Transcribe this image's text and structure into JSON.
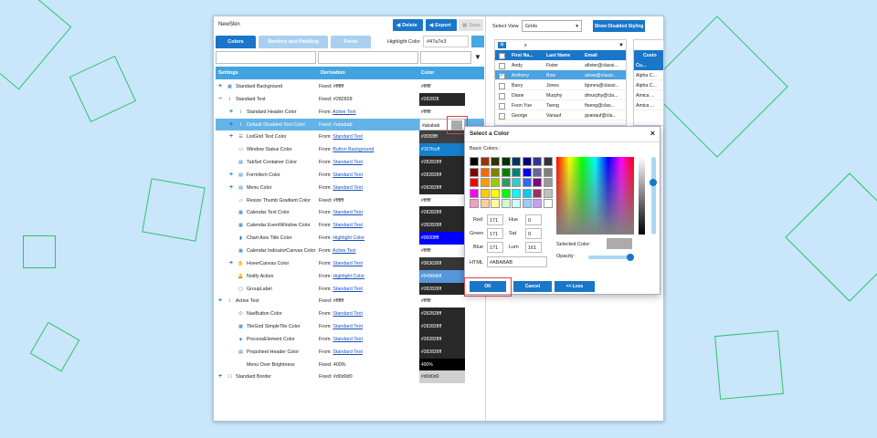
{
  "window": {
    "title": "NewSkin"
  },
  "toolbar": {
    "delete": "Delete",
    "export": "Export",
    "save": "Save"
  },
  "tabs": [
    "Colors",
    "Borders and Padding",
    "Fonts"
  ],
  "highlight": {
    "label": "Highlight Color",
    "value": "#47a7e3",
    "color": "#47a7e3"
  },
  "table": {
    "headers": {
      "settings": "Settings",
      "derivation": "Derivation",
      "color": "Color"
    },
    "rows": [
      {
        "name": "Standard Background",
        "deriv_prefix": "Fixed:",
        "deriv_link": "",
        "deriv_fixed": "#ffffff",
        "value": "#ffffff",
        "swatch": "#ffffff",
        "text_color": "#222222",
        "indent": 0,
        "expander": "+",
        "icon": "grid",
        "selected": false
      },
      {
        "name": "Standard Text",
        "deriv_prefix": "Fixed:",
        "deriv_link": "",
        "deriv_fixed": "#282828",
        "value": "#282828",
        "swatch": "#282828",
        "text_color": "#ffffff",
        "indent": 0,
        "expander": "−",
        "icon": "text",
        "selected": false
      },
      {
        "name": "Standard Header Color",
        "deriv_prefix": "From:",
        "deriv_link": "Active Text",
        "deriv_fixed": "",
        "value": "#ffffff",
        "swatch": "#ffffff",
        "text_color": "#222222",
        "indent": 1,
        "expander": "+",
        "icon": "text",
        "selected": false
      },
      {
        "name": "Default Disabled Text Color",
        "deriv_prefix": "Fixed:",
        "deriv_link": "",
        "deriv_fixed": "#ababab",
        "value": "#ababab",
        "swatch": "#ffffff",
        "text_color": "#222222",
        "indent": 1,
        "expander": "+",
        "icon": "text",
        "selected": true
      },
      {
        "name": "ListGrid Text Color",
        "deriv_prefix": "From:",
        "deriv_link": "Standard Text",
        "deriv_fixed": "",
        "value": "#3f3f3fff",
        "swatch": "#3f3f3f",
        "text_color": "#ffffff",
        "indent": 1,
        "expander": "+",
        "icon": "list",
        "selected": false
      },
      {
        "name": "Window Status Color",
        "deriv_prefix": "From:",
        "deriv_link": "Button Background",
        "deriv_fixed": "",
        "value": "#157fccff",
        "swatch": "#157fcc",
        "text_color": "#ffffff",
        "indent": 1,
        "expander": "",
        "icon": "window",
        "selected": false
      },
      {
        "name": "TabSet Container Color",
        "deriv_prefix": "From:",
        "deriv_link": "Standard Text",
        "deriv_fixed": "",
        "value": "#282828ff",
        "swatch": "#282828",
        "text_color": "#ffffff",
        "indent": 1,
        "expander": "",
        "icon": "tab",
        "selected": false
      },
      {
        "name": "FormItem Color",
        "deriv_prefix": "From:",
        "deriv_link": "Standard Text",
        "deriv_fixed": "",
        "value": "#282828ff",
        "swatch": "#282828",
        "text_color": "#ffffff",
        "indent": 1,
        "expander": "+",
        "icon": "form",
        "selected": false
      },
      {
        "name": "Menu Color",
        "deriv_prefix": "From:",
        "deriv_link": "Standard Text",
        "deriv_fixed": "",
        "value": "#282828ff",
        "swatch": "#282828",
        "text_color": "#ffffff",
        "indent": 1,
        "expander": "+",
        "icon": "menu",
        "selected": false
      },
      {
        "name": "Resize Thumb Gradient Color",
        "deriv_prefix": "Fixed:",
        "deriv_link": "",
        "deriv_fixed": "#ffffff",
        "value": "#ffffff",
        "swatch": "#ffffff",
        "text_color": "#222222",
        "indent": 1,
        "expander": "",
        "icon": "resize",
        "selected": false
      },
      {
        "name": "Calendar Text Color",
        "deriv_prefix": "From:",
        "deriv_link": "Standard Text",
        "deriv_fixed": "",
        "value": "#282828ff",
        "swatch": "#282828",
        "text_color": "#ffffff",
        "indent": 1,
        "expander": "",
        "icon": "calendar",
        "selected": false
      },
      {
        "name": "Calendar EventWindow Color",
        "deriv_prefix": "From:",
        "deriv_link": "Standard Text",
        "deriv_fixed": "",
        "value": "#282828ff",
        "swatch": "#282828",
        "text_color": "#ffffff",
        "indent": 1,
        "expander": "",
        "icon": "calendar",
        "selected": false
      },
      {
        "name": "Chart Axis Title Color",
        "deriv_prefix": "From:",
        "deriv_link": "Highlight Color",
        "deriv_fixed": "",
        "value": "#0000ffff",
        "swatch": "#0000ff",
        "text_color": "#ffffff",
        "indent": 1,
        "expander": "",
        "icon": "chart",
        "selected": false
      },
      {
        "name": "Calendar IndicatorCanvas Color",
        "deriv_prefix": "From:",
        "deriv_link": "Active Text",
        "deriv_fixed": "",
        "value": "#ffffff",
        "swatch": "#ffffff",
        "text_color": "#222222",
        "indent": 1,
        "expander": "",
        "icon": "calendar",
        "selected": false
      },
      {
        "name": "HoverCanvas Color",
        "deriv_prefix": "From:",
        "deriv_link": "Standard Text",
        "deriv_fixed": "",
        "value": "#363636ff",
        "swatch": "#363636",
        "text_color": "#ffffff",
        "indent": 1,
        "expander": "+",
        "icon": "hand",
        "selected": false
      },
      {
        "name": "Notify Action",
        "deriv_prefix": "From:",
        "deriv_link": "Highlight Color",
        "deriv_fixed": "",
        "value": "#5498dbff",
        "swatch": "#5498db",
        "text_color": "#ffffff",
        "indent": 1,
        "expander": "",
        "icon": "bell",
        "selected": false
      },
      {
        "name": "GroupLabel",
        "deriv_prefix": "From:",
        "deriv_link": "Standard Text",
        "deriv_fixed": "",
        "value": "#282828ff",
        "swatch": "#282828",
        "text_color": "#ffffff",
        "indent": 1,
        "expander": "",
        "icon": "group",
        "selected": false
      },
      {
        "name": "Active Text",
        "deriv_prefix": "Fixed:",
        "deriv_link": "",
        "deriv_fixed": "#ffffff",
        "value": "#ffffff",
        "swatch": "#ffffff",
        "text_color": "#222222",
        "indent": 0,
        "expander": "+",
        "icon": "text",
        "selected": false
      },
      {
        "name": "NavButton Color",
        "deriv_prefix": "From:",
        "deriv_link": "Standard Text",
        "deriv_fixed": "",
        "value": "#282828ff",
        "swatch": "#282828",
        "text_color": "#ffffff",
        "indent": 1,
        "expander": "",
        "icon": "power",
        "selected": false
      },
      {
        "name": "TileGrid SimpleTile Color",
        "deriv_prefix": "From:",
        "deriv_link": "Standard Text",
        "deriv_fixed": "",
        "value": "#282828ff",
        "swatch": "#282828",
        "text_color": "#ffffff",
        "indent": 1,
        "expander": "",
        "icon": "tile",
        "selected": false
      },
      {
        "name": "ProcessElement Color",
        "deriv_prefix": "From:",
        "deriv_link": "Standard Text",
        "deriv_fixed": "",
        "value": "#282828ff",
        "swatch": "#282828",
        "text_color": "#ffffff",
        "indent": 1,
        "expander": "",
        "icon": "process",
        "selected": false
      },
      {
        "name": "Propsheet Header Color",
        "deriv_prefix": "From:",
        "deriv_link": "Standard Text",
        "deriv_fixed": "",
        "value": "#282828ff",
        "swatch": "#282828",
        "text_color": "#ffffff",
        "indent": 1,
        "expander": "",
        "icon": "propsheet",
        "selected": false
      },
      {
        "name": "Menu Over Brightness",
        "deriv_prefix": "Fixed:",
        "deriv_link": "",
        "deriv_fixed": "400%",
        "value": "400%",
        "swatch": "#000000",
        "text_color": "#ffffff",
        "indent": 1,
        "expander": "",
        "icon": "none",
        "selected": false
      },
      {
        "name": "Standard Border",
        "deriv_prefix": "Fixed:",
        "deriv_link": "",
        "deriv_fixed": "#d0d0d0",
        "value": "#d0d0d0",
        "swatch": "#d0d0d0",
        "text_color": "#222222",
        "indent": 0,
        "expander": "+",
        "icon": "box",
        "selected": false
      }
    ]
  },
  "preview": {
    "select_view_label": "Select View",
    "select_view_value": "Grids",
    "show_disabled": "Show Disabled Styling",
    "grid": {
      "filter": "x",
      "headers": [
        "First Na...",
        "Last Name",
        "Email"
      ],
      "rows": [
        [
          "Andy",
          "Fixter",
          "afixter@classi..."
        ],
        [
          "Anthony",
          "Bow",
          "abow@classi..."
        ],
        [
          "Barry",
          "Jones",
          "bjones@classi..."
        ],
        [
          "Diane",
          "Murphy",
          "dmurphy@cla..."
        ],
        [
          "Foon Yue",
          "Tseng",
          "ftseng@clas..."
        ],
        [
          "George",
          "Vanauf",
          "gvanauf@cla..."
        ]
      ],
      "selected_index": 1
    },
    "grid2": {
      "header": "Custo",
      "sub": "Cu...",
      "rows": [
        "Alpha C...",
        "Alpha C...",
        "Amica ...",
        "Amica ..."
      ]
    }
  },
  "dialog": {
    "title": "Select a Color",
    "basic_colors_label": "Basic Colors :",
    "basic_colors": [
      "#000000",
      "#993300",
      "#333300",
      "#003300",
      "#003366",
      "#000080",
      "#333399",
      "#333333",
      "#800000",
      "#ff6600",
      "#808000",
      "#008000",
      "#008080",
      "#0000ff",
      "#666699",
      "#808080",
      "#ff0000",
      "#ff9900",
      "#99cc00",
      "#339966",
      "#33cccc",
      "#3366ff",
      "#800080",
      "#999999",
      "#ff00ff",
      "#ffcc00",
      "#ffff00",
      "#00ff00",
      "#00ffff",
      "#00ccff",
      "#993366",
      "#c0c0c0",
      "#ff99cc",
      "#ffcc99",
      "#ffff99",
      "#ccffcc",
      "#ccffff",
      "#99ccff",
      "#cc99ff",
      "#ffffff"
    ],
    "fields": {
      "red_label": "Red",
      "red": "171",
      "green_label": "Green",
      "green": "171",
      "blue_label": "Blue",
      "blue": "171",
      "hue_label": "Hue",
      "hue": "0",
      "sat_label": "Sat",
      "sat": "0",
      "lum_label": "Lum",
      "lum": "161",
      "html_label": "HTML",
      "html": "#ABABAB"
    },
    "selected_color_label": "Selected Color:",
    "selected_color": "#ababab",
    "opacity_label": "Opacity:",
    "opacity": 1.0,
    "buttons": {
      "ok": "OK",
      "cancel": "Cancel",
      "less": "<< Less"
    }
  },
  "cell_input": {
    "value": "#ababab"
  }
}
